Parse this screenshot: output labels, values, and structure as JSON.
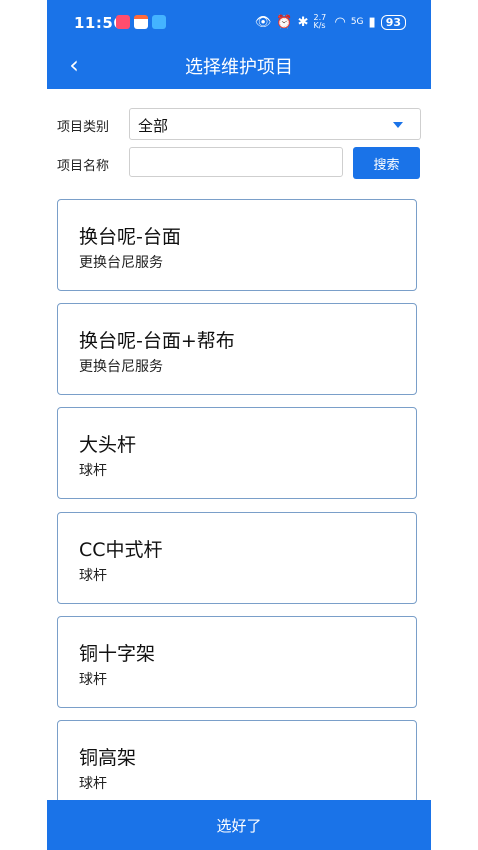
{
  "status_bar": {
    "time": "11:56",
    "net_speed": "2.7 K/s",
    "signal": "5G",
    "battery": "93"
  },
  "header": {
    "title": "选择维护项目",
    "back_icon": "chevron-left-icon"
  },
  "filters": {
    "category_label": "项目类别",
    "category_value": "全部",
    "name_label": "项目名称",
    "name_value": "",
    "search_label": "搜索"
  },
  "items": [
    {
      "name": "换台呢-台面",
      "type": "更换台尼服务"
    },
    {
      "name": "换台呢-台面+帮布",
      "type": "更换台尼服务"
    },
    {
      "name": "大头杆",
      "type": "球杆"
    },
    {
      "name": "CC中式杆",
      "type": "球杆"
    },
    {
      "name": "铜十字架",
      "type": "球杆"
    },
    {
      "name": "铜高架",
      "type": "球杆"
    }
  ],
  "footer": {
    "confirm_label": "选好了"
  },
  "colors": {
    "primary": "#1a73e8",
    "card_border": "#7a9fc9"
  }
}
